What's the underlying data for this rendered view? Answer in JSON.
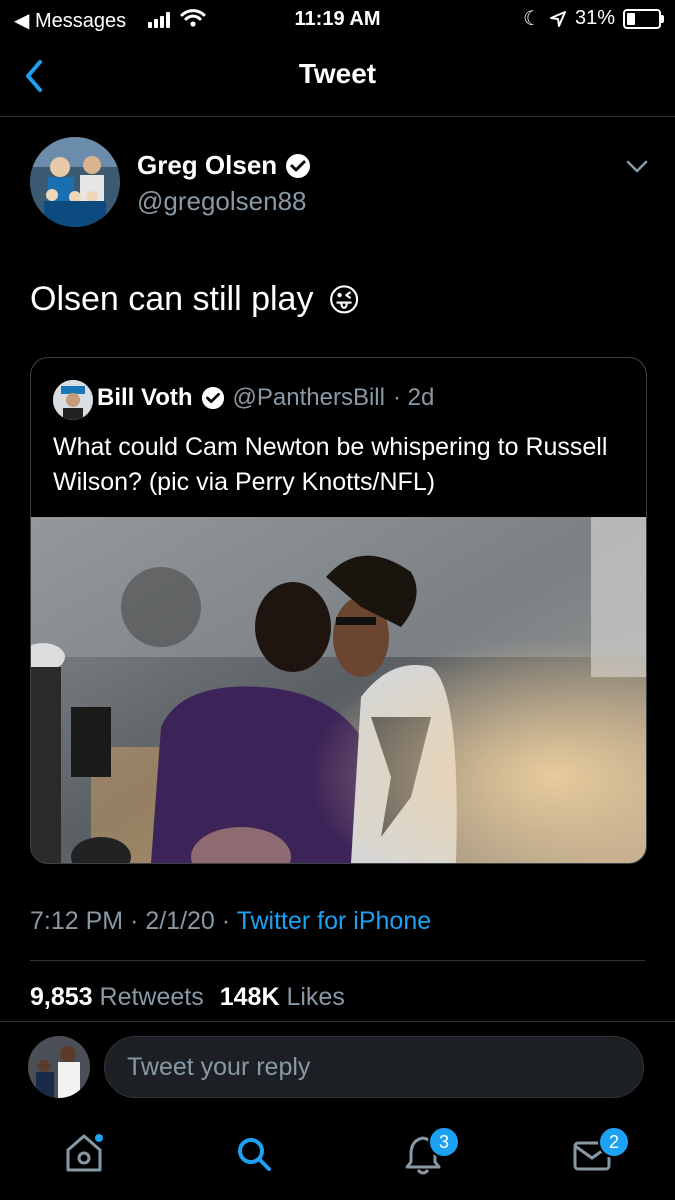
{
  "status_bar": {
    "back_app": "◀ Messages",
    "time": "11:19 AM",
    "battery": "31%",
    "battery_level": 0.31
  },
  "nav": {
    "title": "Tweet"
  },
  "tweet": {
    "author_name": "Greg Olsen",
    "author_handle": "@gregolsen88",
    "text": "Olsen can still play",
    "emoji": "😜",
    "timestamp": "7:12 PM · 2/1/20 · ",
    "source": "Twitter for iPhone",
    "retweets_count": "9,853",
    "retweets_label": "Retweets",
    "likes_count": "148K",
    "likes_label": "Likes"
  },
  "quoted": {
    "author_name": "Bill Voth",
    "author_handle": "@PanthersBill",
    "age": "· 2d",
    "text": "What could Cam Newton be whispering to Russell Wilson? (pic via Perry Knotts/NFL)"
  },
  "reply": {
    "placeholder": "Tweet your reply"
  },
  "tabs": {
    "notifications_badge": "3",
    "messages_badge": "2"
  },
  "colors": {
    "accent": "#1da1f2",
    "muted": "#8899a6",
    "background": "#000000"
  }
}
